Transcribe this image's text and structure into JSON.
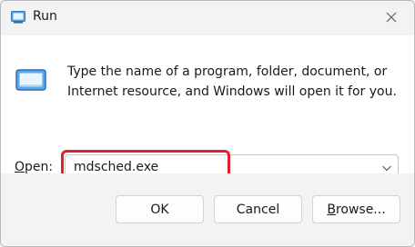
{
  "window": {
    "title": "Run",
    "icon": "run-icon",
    "close_icon": "close-icon"
  },
  "dialog": {
    "description_line1": "Type the name of a program, folder, document, or",
    "description_line2": "Internet resource, and Windows will open it for you.",
    "open_label_accel": "O",
    "open_label_rest": "pen:",
    "open_value": "mdsched.exe",
    "highlight_color": "#e0202a"
  },
  "buttons": {
    "ok_label": "OK",
    "cancel_label": "Cancel",
    "browse_accel": "B",
    "browse_rest": "rowse..."
  }
}
